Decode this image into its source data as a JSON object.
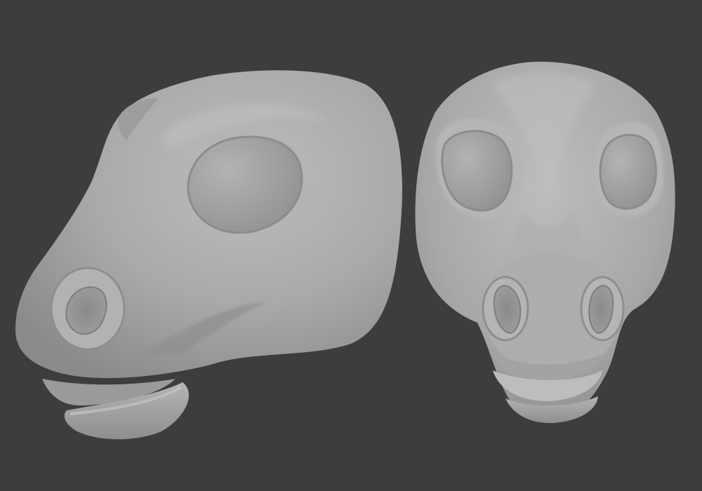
{
  "scene": {
    "background_color": "#3d3d3d",
    "material_color": "#a7a7a7",
    "models": [
      {
        "name": "horse-head-side-view"
      },
      {
        "name": "horse-head-front-view"
      }
    ]
  }
}
